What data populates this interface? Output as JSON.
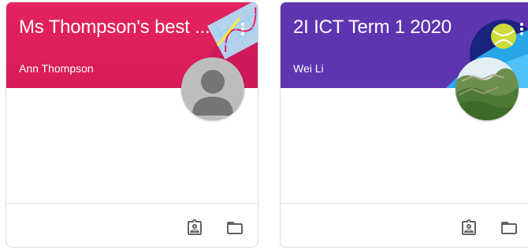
{
  "cards": [
    {
      "title": "Ms Thompson's best ...",
      "teacher": "Ann Thompson",
      "header_color": "#e01e5a",
      "avatar": "default-person-avatar",
      "actions": [
        "assignment-ind-icon",
        "folder-icon"
      ]
    },
    {
      "title": "2I ICT Term 1 2020",
      "teacher": "Wei Li",
      "header_color": "#5e35b1",
      "avatar": "landscape-photo-avatar",
      "actions": [
        "assignment-ind-icon",
        "folder-icon"
      ]
    }
  ]
}
